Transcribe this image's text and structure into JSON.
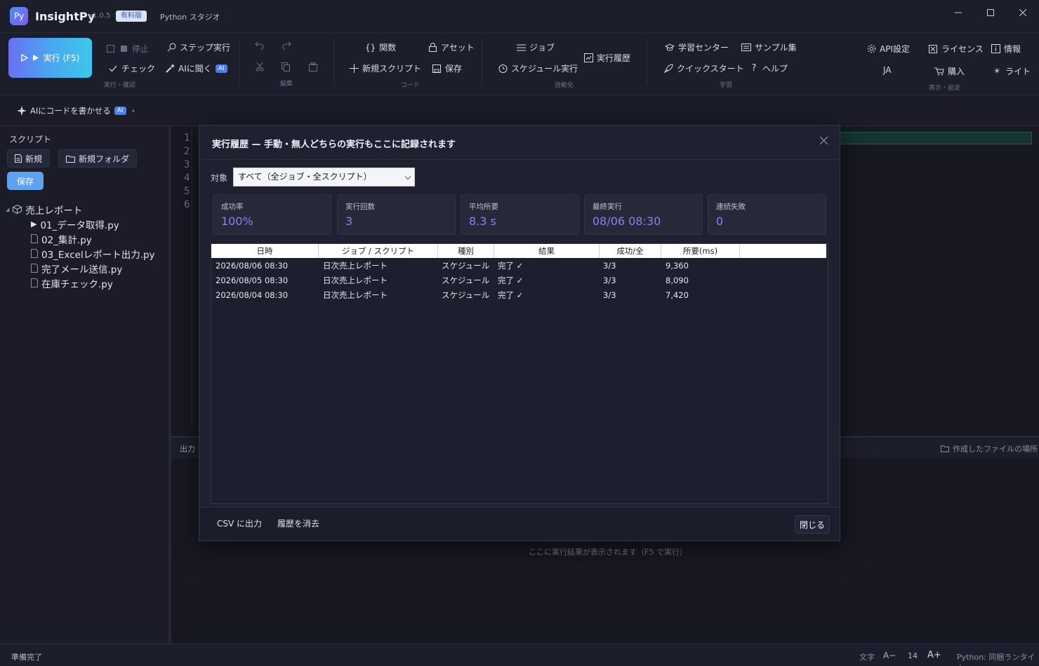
{
  "titlebar": {
    "logo": "Py",
    "app_name": "InsightPy",
    "version": "v1.0.5",
    "edition_badge": "有料版",
    "subtitle": "Python スタジオ"
  },
  "ribbon": {
    "run_label": "実行 (F5)",
    "stop_label": "停止",
    "step_label": "ステップ実行",
    "check_label": "チェック",
    "ask_ai_label": "AIに聞く",
    "ai_badge": "AI",
    "group_run": "実行・確認",
    "group_edit": "編集",
    "functions_label": "関数",
    "assets_label": "アセット",
    "new_script_label": "新規スクリプト",
    "save_label": "保存",
    "group_code": "コード",
    "jobs_label": "ジョブ",
    "schedule_label": "スケジュール実行",
    "history_label": "実行履歴",
    "group_automation": "自動化",
    "learning_center_label": "学習センター",
    "samples_label": "サンプル集",
    "quickstart_label": "クイックスタート",
    "help_label": "ヘルプ",
    "group_learning": "学習",
    "api_label": "API設定",
    "license_label": "ライセンス",
    "info_label": "情報",
    "lang_label": "JA",
    "purchase_label": "購入",
    "theme_label": "ライト",
    "group_view": "表示・設定"
  },
  "aibar": {
    "label": "AIにコードを書かせる",
    "badge": "AI"
  },
  "sidebar": {
    "title": "スクリプト",
    "new_label": "新規",
    "new_folder_label": "新規フォルダ",
    "save_label": "保存",
    "folder": "売上レポート",
    "files": [
      "01_データ取得.py",
      "02_集計.py",
      "03_Excelレポート出力.py",
      "完了メール送信.py",
      "在庫チェック.py"
    ]
  },
  "editor": {
    "line_numbers": [
      "1",
      "2",
      "3",
      "4",
      "5",
      "6"
    ]
  },
  "output": {
    "title": "出力",
    "open_folder_label": "作成したファイルの場所",
    "placeholder": "ここに実行結果が表示されます（F5 で実行）"
  },
  "status": {
    "ready": "準備完了",
    "font_label": "文字",
    "decrease": "A−",
    "font_size": "14",
    "increase": "A+",
    "runtime": "Python: 同梱ランタイム"
  },
  "modal": {
    "title": "実行履歴 — 手動・無人どちらの実行もここに記録されます",
    "target_label": "対象",
    "target_value": "すべて（全ジョブ・全スクリプト）",
    "stats": [
      {
        "label": "成功率",
        "value": "100%"
      },
      {
        "label": "実行回数",
        "value": "3"
      },
      {
        "label": "平均所要",
        "value": "8.3 s"
      },
      {
        "label": "最終実行",
        "value": "08/06 08:30"
      },
      {
        "label": "連続失敗",
        "value": "0"
      }
    ],
    "columns": [
      "日時",
      "ジョブ / スクリプト",
      "種別",
      "結果",
      "成功/全",
      "所要(ms)"
    ],
    "rows": [
      [
        "2026/08/06 08:30",
        "日次売上レポート",
        "スケジュール",
        "完了 ✓",
        "3/3",
        "9,360"
      ],
      [
        "2026/08/05 08:30",
        "日次売上レポート",
        "スケジュール",
        "完了 ✓",
        "3/3",
        "8,090"
      ],
      [
        "2026/08/04 08:30",
        "日次売上レポート",
        "スケジュール",
        "完了 ✓",
        "3/3",
        "7,420"
      ]
    ],
    "csv_label": "CSV に出力",
    "clear_label": "履歴を消去",
    "close_label": "閉じる"
  }
}
